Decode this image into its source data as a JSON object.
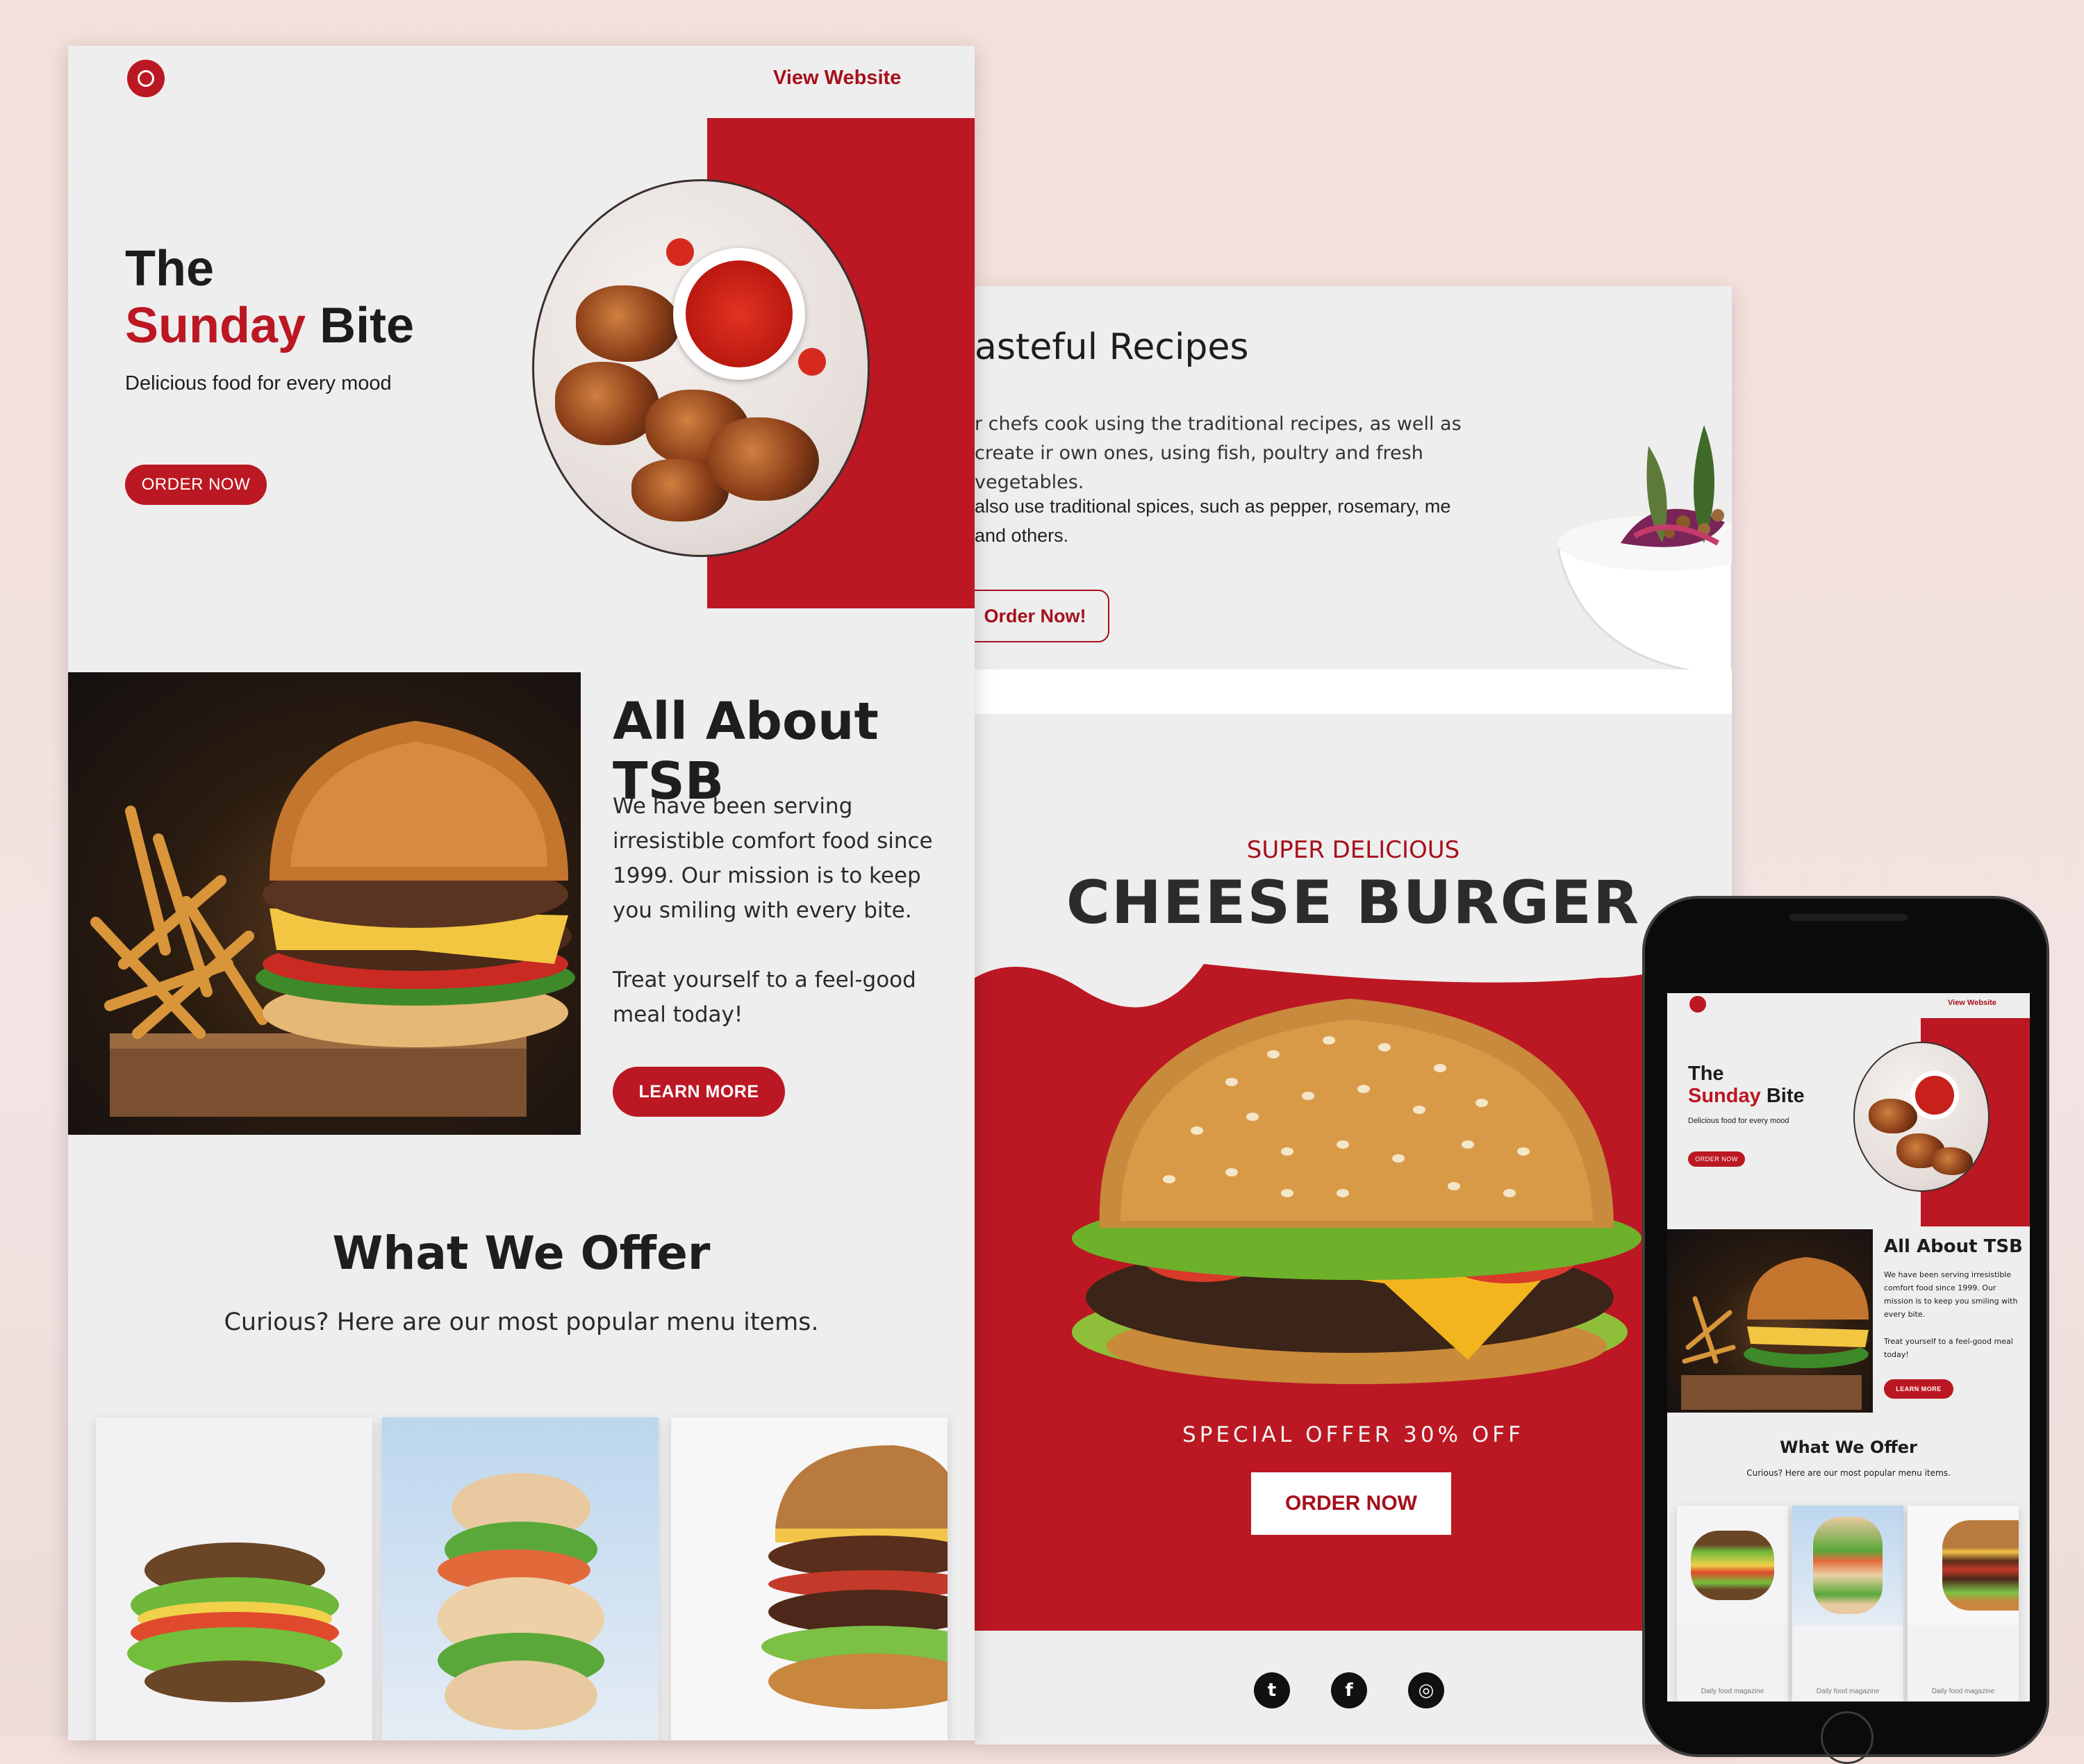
{
  "left_email": {
    "header": {
      "view_website": "View Website",
      "logo_icon": "sun-logo-icon"
    },
    "hero": {
      "title_line1": "The",
      "title_red": "Sunday",
      "title_black": "Bite",
      "tagline": "Delicious food for every mood",
      "cta": "ORDER NOW"
    },
    "about": {
      "heading": "All About TSB",
      "para1": "We have been serving irresistible comfort food since 1999. Our mission is to keep you smiling with every bite.",
      "para2": "Treat yourself to a feel-good meal today!",
      "cta": "LEARN MORE"
    },
    "offer": {
      "heading": "What We Offer",
      "subheading": "Curious? Here are our most popular menu items."
    }
  },
  "middle_email": {
    "recipes": {
      "heading": "asteful Recipes",
      "para1": "r chefs cook using the traditional recipes, as well as create ir own ones, using fish, poultry and fresh vegetables.",
      "para2": "also use traditional spices, such as pepper, rosemary, me and others.",
      "cta": "Order Now!"
    },
    "promo": {
      "kicker": "SUPER DELICIOUS",
      "title": "CHEESE BURGER",
      "offer": "SPECIAL OFFER 30% OFF",
      "cta": "ORDER NOW"
    },
    "social": {
      "twitter": "twitter-icon",
      "facebook": "facebook-icon",
      "instagram": "instagram-icon",
      "twitter_glyph": "t",
      "facebook_glyph": "f",
      "instagram_glyph": "◎"
    }
  },
  "phone": {
    "view_website": "View Website",
    "title_line1": "The",
    "title_red": "Sunday",
    "title_black": "Bite",
    "tagline": "Delicious food for every mood",
    "cta": "ORDER NOW",
    "about_heading": "All About TSB",
    "about_para1": "We have been serving irresistible comfort food since 1999. Our mission is to keep you smiling with every bite.",
    "about_para2": "Treat yourself to a feel-good meal today!",
    "about_cta": "LEARN MORE",
    "offer_heading": "What We Offer",
    "offer_sub": "Curious? Here are our most popular menu items.",
    "captions": [
      "Daily food magazine",
      "Daily food magazine",
      "Daily food magazine"
    ]
  },
  "colors": {
    "brand_red": "#bb1823",
    "background": "#efeeee"
  }
}
